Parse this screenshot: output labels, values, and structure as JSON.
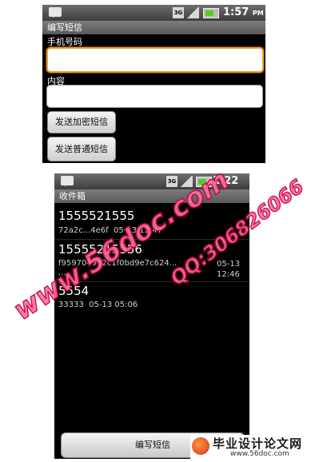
{
  "compose_screen": {
    "status_time": "1:57",
    "status_ampm": "PM",
    "network_label": "3G",
    "title": "编写短信",
    "phone_label": "手机号码",
    "phone_value": "",
    "content_label": "内容",
    "content_value": "",
    "send_encrypted_label": "发送加密短信",
    "send_normal_label": "发送普通短信"
  },
  "inbox_screen": {
    "status_time": "1:22",
    "status_ampm": "PM",
    "network_label": "3G",
    "title": "收件箱",
    "messages": [
      {
        "number": "1555521555",
        "preview": "72a2c...4e6f",
        "date": "05-13 12:47"
      },
      {
        "number": "15555215556",
        "preview": "f9597049​32c1f0bd9e7c624...",
        "preview_cont": "...",
        "date": "05-13",
        "time": "12:46"
      },
      {
        "number": "5554",
        "preview": "33333",
        "date": "05-13 05:06"
      }
    ],
    "compose_button_label": "编写短信"
  },
  "watermark": {
    "site_text": "www.56doc.com",
    "qq_text": "QQ:306826066",
    "logo_title": "毕业设计论文网",
    "logo_url": "www.56doc.com"
  }
}
